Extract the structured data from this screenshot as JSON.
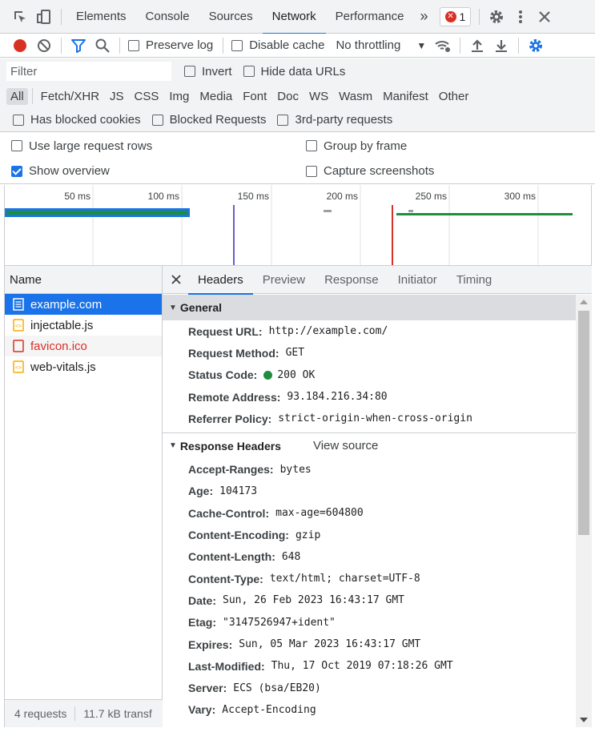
{
  "tabs": {
    "elements": "Elements",
    "console": "Console",
    "sources": "Sources",
    "network": "Network",
    "performance": "Performance",
    "more": "»",
    "error_count": "1"
  },
  "toolbar": {
    "preserve_log": "Preserve log",
    "disable_cache": "Disable cache",
    "throttling": "No throttling"
  },
  "filter": {
    "placeholder": "Filter",
    "invert": "Invert",
    "hide_data_urls": "Hide data URLs"
  },
  "types": [
    "All",
    "Fetch/XHR",
    "JS",
    "CSS",
    "Img",
    "Media",
    "Font",
    "Doc",
    "WS",
    "Wasm",
    "Manifest",
    "Other"
  ],
  "blocked": {
    "has_blocked_cookies": "Has blocked cookies",
    "blocked_requests": "Blocked Requests",
    "third_party": "3rd-party requests"
  },
  "settings": {
    "large_rows": "Use large request rows",
    "show_overview": "Show overview",
    "group_by_frame": "Group by frame",
    "capture_screenshots": "Capture screenshots"
  },
  "overview": {
    "ticks": [
      "50 ms",
      "100 ms",
      "150 ms",
      "200 ms",
      "250 ms",
      "300 ms"
    ]
  },
  "requests": {
    "header": "Name",
    "items": [
      {
        "name": "example.com",
        "type": "doc"
      },
      {
        "name": "injectable.js",
        "type": "script"
      },
      {
        "name": "favicon.ico",
        "type": "error"
      },
      {
        "name": "web-vitals.js",
        "type": "script"
      }
    ],
    "footer_count": "4 requests",
    "footer_transfer": "11.7 kB transf"
  },
  "detail_tabs": {
    "headers": "Headers",
    "preview": "Preview",
    "response": "Response",
    "initiator": "Initiator",
    "timing": "Timing"
  },
  "general": {
    "title": "General",
    "request_url_k": "Request URL:",
    "request_url_v": "http://example.com/",
    "request_method_k": "Request Method:",
    "request_method_v": "GET",
    "status_code_k": "Status Code:",
    "status_code_v": "200 OK",
    "remote_address_k": "Remote Address:",
    "remote_address_v": "93.184.216.34:80",
    "referrer_policy_k": "Referrer Policy:",
    "referrer_policy_v": "strict-origin-when-cross-origin"
  },
  "response_headers": {
    "title": "Response Headers",
    "view_source": "View source",
    "items": [
      {
        "k": "Accept-Ranges:",
        "v": "bytes"
      },
      {
        "k": "Age:",
        "v": "104173"
      },
      {
        "k": "Cache-Control:",
        "v": "max-age=604800"
      },
      {
        "k": "Content-Encoding:",
        "v": "gzip"
      },
      {
        "k": "Content-Length:",
        "v": "648"
      },
      {
        "k": "Content-Type:",
        "v": "text/html; charset=UTF-8"
      },
      {
        "k": "Date:",
        "v": "Sun, 26 Feb 2023 16:43:17 GMT"
      },
      {
        "k": "Etag:",
        "v": "\"3147526947+ident\""
      },
      {
        "k": "Expires:",
        "v": "Sun, 05 Mar 2023 16:43:17 GMT"
      },
      {
        "k": "Last-Modified:",
        "v": "Thu, 17 Oct 2019 07:18:26 GMT"
      },
      {
        "k": "Server:",
        "v": "ECS (bsa/EB20)"
      },
      {
        "k": "Vary:",
        "v": "Accept-Encoding"
      }
    ]
  },
  "colors": {
    "accent": "#1a73e8",
    "record": "#d93025",
    "success": "#1e8e3e"
  }
}
